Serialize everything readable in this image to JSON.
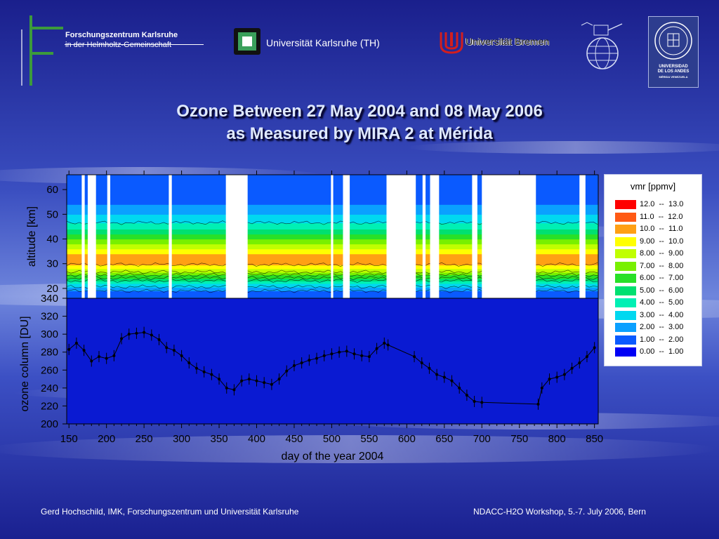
{
  "header": {
    "fzk_line1": "Forschungszentrum Karlsruhe",
    "fzk_line2": "in der Helmholtz-Gemeinschaft",
    "uka": "Universität Karlsruhe (TH)",
    "ubremen": "Universität Bremen",
    "ula_lines": [
      "UNIVERSIDAD",
      "DE LOS ANDES",
      "MÉRIDA VENEZUELA"
    ]
  },
  "title_line1": "Ozone Between 27 May 2004 and 08 May 2006",
  "title_line2": "as Measured by MIRA 2 at Mérida",
  "footer": {
    "left": "Gerd Hochschild, IMK, Forschungszentrum und Universität Karlsruhe",
    "right": "NDACC-H2O Workshop, 5.-7. July 2006, Bern"
  },
  "legend": {
    "title": "vmr [ppmv]",
    "entries": [
      {
        "label": "12.0  --  13.0",
        "color": "#ff0000"
      },
      {
        "label": "11.0  --  12.0",
        "color": "#ff5a14"
      },
      {
        "label": "10.0  --  11.0",
        "color": "#ffa014"
      },
      {
        "label": "9.00  --  10.0",
        "color": "#ffff00"
      },
      {
        "label": "8.00  --  9.00",
        "color": "#c0ff00"
      },
      {
        "label": "7.00  --  8.00",
        "color": "#78f000"
      },
      {
        "label": "6.00  --  7.00",
        "color": "#28e028"
      },
      {
        "label": "5.00  --  6.00",
        "color": "#00e070"
      },
      {
        "label": "4.00  --  5.00",
        "color": "#00f0b4"
      },
      {
        "label": "3.00  --  4.00",
        "color": "#00d8f0"
      },
      {
        "label": "2.00  --  3.00",
        "color": "#0aa0ff"
      },
      {
        "label": "1.00  --  2.00",
        "color": "#0a5aff"
      },
      {
        "label": "0.00  --  1.00",
        "color": "#0000f5"
      }
    ]
  },
  "colors": {
    "plot_bg": "#0a1ad2",
    "gap": "#ffffff",
    "axis_text": "#000000",
    "column_marks": "#000000"
  },
  "chart_data": [
    {
      "type": "heatmap",
      "title": "",
      "xlabel": "",
      "ylabel": "altitude [km]",
      "xlim": [
        147,
        855
      ],
      "ylim": [
        16,
        66
      ],
      "yticks": [
        20,
        30,
        40,
        50,
        60
      ],
      "color_variable": "vmr [ppmv]",
      "data_gaps_day_ranges": [
        [
          167,
          171
        ],
        [
          175,
          186
        ],
        [
          201,
          205
        ],
        [
          283,
          287
        ],
        [
          359,
          388
        ],
        [
          499,
          502
        ],
        [
          515,
          524
        ],
        [
          573,
          612
        ],
        [
          621,
          625
        ],
        [
          631,
          643
        ],
        [
          687,
          694
        ],
        [
          700,
          772
        ],
        [
          830,
          838
        ]
      ],
      "profile": {
        "altitude_km": [
          18,
          20,
          22,
          24,
          26,
          28,
          30,
          32,
          34,
          36,
          38,
          40,
          42,
          44,
          46,
          48,
          50,
          52,
          54,
          56,
          58,
          60,
          62,
          64,
          66
        ],
        "vmr_ppmv": [
          1.5,
          2.5,
          4.0,
          5.8,
          7.5,
          9.0,
          10.2,
          10.6,
          10.0,
          9.0,
          8.0,
          7.0,
          6.0,
          5.0,
          4.2,
          3.5,
          3.0,
          2.5,
          2.0,
          1.5,
          1.5,
          1.7,
          1.8,
          1.7,
          1.6
        ]
      }
    },
    {
      "type": "scatter",
      "title": "",
      "xlabel": "day of the year 2004",
      "ylabel": "ozone column [DU]",
      "xlim": [
        147,
        855
      ],
      "ylim": [
        200,
        340
      ],
      "xticks": [
        150,
        200,
        250,
        300,
        350,
        400,
        450,
        500,
        550,
        600,
        650,
        700,
        750,
        800,
        850
      ],
      "yticks": [
        200,
        220,
        240,
        260,
        280,
        300,
        320,
        340
      ],
      "grid": false,
      "x": [
        150,
        160,
        170,
        180,
        190,
        200,
        210,
        220,
        230,
        240,
        250,
        260,
        270,
        280,
        290,
        300,
        310,
        320,
        330,
        340,
        350,
        360,
        370,
        380,
        390,
        400,
        410,
        420,
        430,
        440,
        450,
        460,
        470,
        480,
        490,
        500,
        510,
        520,
        530,
        540,
        550,
        560,
        570,
        575,
        610,
        620,
        630,
        640,
        650,
        660,
        670,
        680,
        690,
        700,
        775,
        780,
        790,
        800,
        810,
        820,
        830,
        840,
        850
      ],
      "y": [
        283,
        290,
        282,
        270,
        275,
        273,
        276,
        295,
        300,
        301,
        302,
        299,
        294,
        285,
        282,
        276,
        268,
        262,
        258,
        255,
        250,
        240,
        238,
        248,
        250,
        248,
        246,
        244,
        250,
        259,
        265,
        268,
        271,
        273,
        276,
        278,
        280,
        281,
        278,
        276,
        275,
        284,
        290,
        288,
        275,
        268,
        262,
        255,
        252,
        248,
        240,
        232,
        225,
        224,
        222,
        240,
        250,
        252,
        255,
        262,
        268,
        275,
        285
      ]
    }
  ]
}
